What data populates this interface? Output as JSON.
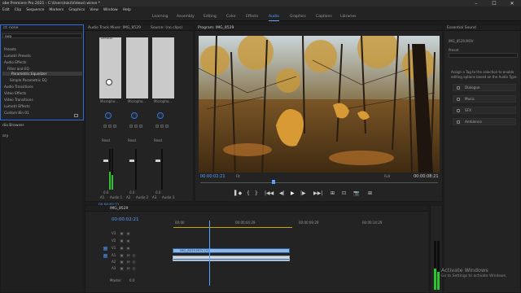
{
  "window": {
    "title": "obe Premiere Pro 2021 - C:\\Users\\loki\\Videos\\ winse *",
    "minimize": "–",
    "maximize": "☐",
    "close": "✕"
  },
  "menu": [
    "Edit",
    "Clip",
    "Sequence",
    "Markers",
    "Graphics",
    "View",
    "Window",
    "Help"
  ],
  "workspaces": [
    {
      "label": "Learning",
      "active": false
    },
    {
      "label": "Assembly",
      "active": false
    },
    {
      "label": "Editing",
      "active": false
    },
    {
      "label": "Color",
      "active": false
    },
    {
      "label": "Effects",
      "active": false
    },
    {
      "label": "Audio",
      "active": true
    },
    {
      "label": "Graphics",
      "active": false
    },
    {
      "label": "Captions",
      "active": false
    },
    {
      "label": "Libraries",
      "active": false
    }
  ],
  "effects_panel": {
    "tab": "ct: none",
    "search": "ewa",
    "items": [
      "Presets",
      "Lumetri Presets",
      "Audio Effects",
      "Filter and EQ",
      "Parametric Equalizer",
      "Simple Parametric EQ",
      "Audio Transitions",
      "Video Effects",
      "Video Transitions",
      "Lumetri Effects",
      "Custom Bin 01"
    ],
    "selected_index": 4,
    "lower_tabs": [
      "dia Browser",
      "ary"
    ]
  },
  "mixer": {
    "tab": "Audio Track Mixer: IMG_8529",
    "tab2": "Source: (no clips)",
    "channels": [
      {
        "name": "Audio 1",
        "track": "A1",
        "read": "Read",
        "db": "0.0",
        "mic": "Micropho..."
      },
      {
        "name": "Audio 2",
        "track": "A2",
        "read": "Read",
        "db": "0.0",
        "mic": "Micropho..."
      },
      {
        "name": "Audio 3",
        "track": "A3",
        "read": "Read",
        "db": "0.0",
        "mic": "Micropho..."
      }
    ],
    "default_label": "Default",
    "timecode": "00:00:02:21"
  },
  "program": {
    "tab": "Program: IMG_8529",
    "timecode_left": "00:00:02:21",
    "fit": "Fit",
    "quality": "Full",
    "timecode_right": "00:00:08:21",
    "controls": [
      "▌◆",
      "{",
      "}",
      "|◀◀",
      "◀|",
      "▶",
      "|▶",
      "▶▶|",
      "⊞",
      "⊡",
      "📷",
      "⊞"
    ]
  },
  "essential_sound": {
    "tab": "Essential Sound",
    "sequence": "IMG_8529.MOV",
    "preset_label": "Preset",
    "hint": "Assign a Tag to the selection to enable editing options based on the Audio Type.",
    "buttons": [
      "Dialogue",
      "Music",
      "SFX",
      "Ambience"
    ]
  },
  "timeline": {
    "tab": "IMG_8529",
    "timecode": "00:00:02:21",
    "ruler": [
      "00:00",
      "00:00:04:29",
      "00:00:09:29",
      "00:00:14:29"
    ],
    "video_tracks": [
      "V3",
      "V2",
      "V1"
    ],
    "audio_tracks": [
      "A1",
      "A2",
      "A3"
    ],
    "clip_video": "IMG_8529.MOV [V]",
    "clip_audio": "",
    "master": "Master",
    "master_value": "0.0"
  },
  "watermark": {
    "line1": "Activate Windows",
    "line2": "Go to Settings to activate Windows."
  }
}
